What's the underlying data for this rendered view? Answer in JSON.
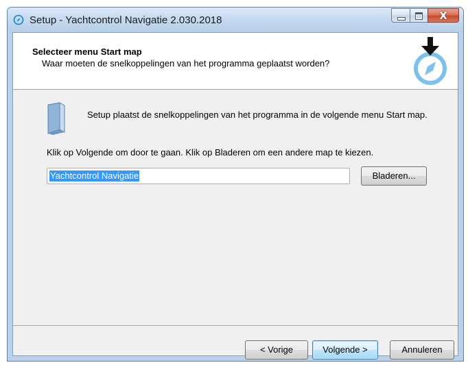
{
  "window": {
    "title": "Setup - Yachtcontrol Navigatie 2.030.2018",
    "close_glyph": "X"
  },
  "header": {
    "title": "Selecteer menu Start map",
    "subtitle": "Waar moeten de snelkoppelingen van het programma geplaatst worden?",
    "icon": "compass-download-icon"
  },
  "body": {
    "info": "Setup plaatst de snelkoppelingen van het programma in de volgende menu Start map.",
    "instruction": "Klik op Volgende om door te gaan. Klik op Bladeren om een andere map te kiezen.",
    "folder_value": "Yachtcontrol Navigatie",
    "browse_label": "Bladeren..."
  },
  "footer": {
    "back_label": "< Vorige",
    "next_label": "Volgende >",
    "cancel_label": "Annuleren"
  },
  "colors": {
    "accent": "#1f8ad6",
    "selection": "#3399ff",
    "arrow": "#111111"
  }
}
